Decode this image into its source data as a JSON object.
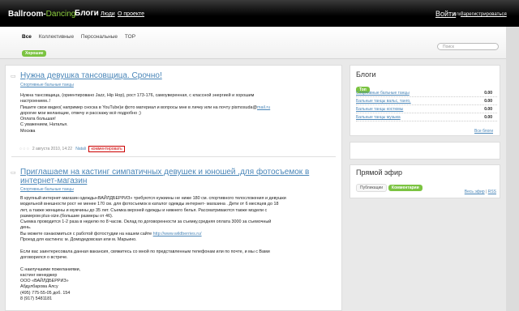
{
  "topbar": {
    "logo_main": "Ballroom-",
    "logo_accent": "Dancing",
    "nav_blogs": "Блоги",
    "nav_people": "Люди",
    "nav_about": "О проекте",
    "login": "Войти",
    "or": "или",
    "register": "Зарегистрироваться"
  },
  "filters": {
    "items": [
      "Все",
      "Коллективные",
      "Персональные",
      "TOP"
    ],
    "sub_badge": "Хорошие",
    "search_placeholder": "Поиск"
  },
  "post1": {
    "title": "Нужна девушка тансовщица. Срочно!",
    "category": "Спортивные бальные танцы",
    "lines": [
      "Нужна тансовщица, (ориентировано Jazz, Hip Hop), рост 173-176, самоуверенная, с классной энергией и хорошим",
      "настроением..!",
      "Пишите свои видео( например сноска в YouTube)и фото материал и вопросы мне в личку или на почту pismosuda@",
      "дорогие мои желающие, отвечу и расскажу всё подробно ;)",
      "Оплата большая!",
      "С уважением, Наталья.",
      "Москва"
    ],
    "email_link": "mail.ru",
    "meta_date": "2 августа 2010, 14:22",
    "meta_author": "Natali",
    "meta_comment": "комментировать"
  },
  "post2": {
    "title": "Приглашаем на кастинг симпатичных девушек и юношей ,для фотосъемок в интернет-магазин",
    "category": "Спортивные бальные танцы",
    "lines": [
      "В крупный интернет-магазин одежды«ВАЙЛДБЕРРИЗ» требуются нужиины не ниже 180 см. спортивного телосложения и девушки",
      "модельной внешности рост не менее 170 см. для фотосъемок в каталог одежды интернет- магазина . Дети от 6 месяцев до 18",
      "лет, а также женщины и мужчины до 35 лет. Съемка верхней одежды и нижнего белья. Рассматриваются также модели с",
      "размером plus-size.(большие размеры от 46).",
      "Съемка проводится 1-2 раза в неделю по 8 часов. Оклад по договоренности за съемку,средняя оплата 3000 за съемочный",
      "день.",
      "Вы можете ознакомиться с работой фотостудии на нашем сайте",
      "Проезд для кастинга: м. Домодедовская или м. Марьино."
    ],
    "site_link": "http://www.wildberries.ru/",
    "lines2": [
      "Если вас заинтересовала данная вакансия, свяжитесь со мной по представленным телефонам или по почте, и мы с Вами",
      "договорился о встрече."
    ],
    "sign": [
      "С наилучшими пожеланиями,",
      "кастинг менеджер",
      "ООО «ВАЙЛДБЕРРИЗ»",
      "Абдулбарова Алсу",
      "(495) 775-55-05 доб. 154",
      "8 (917) 5481181"
    ]
  },
  "sidebar": {
    "blogs_title": "Блоги",
    "blogs_badge": "Топ",
    "blogs": [
      {
        "name": "Спортивные бальные танцы",
        "score": "0.00"
      },
      {
        "name": "Бальные танцы вальс, танго,",
        "score": "0.00"
      },
      {
        "name": "Бальные танцы костюмы",
        "score": "0.00"
      },
      {
        "name": "Бальные танцы музыка",
        "score": "0.00"
      }
    ],
    "all_blogs": "Все блоги",
    "live_title": "Прямой эфир",
    "live_tabs": [
      "Публикации",
      "Комментарии"
    ],
    "all_live": "Весь эфир",
    "rss": "RSS"
  }
}
